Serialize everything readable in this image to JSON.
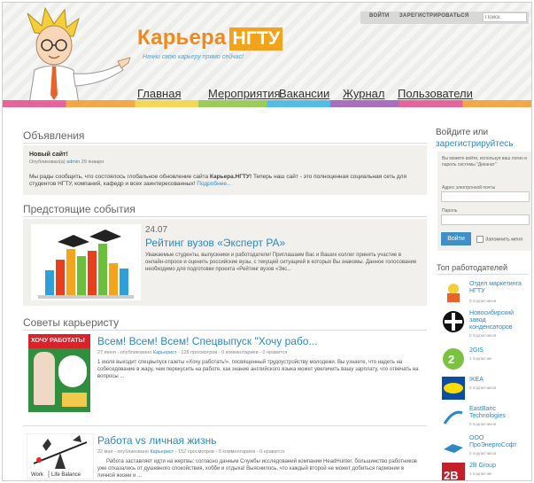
{
  "header": {
    "logo_text": "Карьера",
    "logo_box": "НГТУ",
    "tagline": "Начни свою карьеру прямо сейчас!",
    "login_link": "ВОЙТИ",
    "register_link": "ЗАРЕГИСТРИРОВАТЬСЯ",
    "search_placeholder": "Поиск",
    "nav": [
      "Главная",
      "Мероприятия",
      "Вакансии",
      "Журнал",
      "Пользователи"
    ]
  },
  "announcements": {
    "title": "Объявления",
    "item_title": "Новый сайт!",
    "meta_prefix": "Опубликовал(а)",
    "meta_author": "admin",
    "meta_date": "29 января",
    "text_1": "Мы рады сообщить, что состоялось глобальное обновление сайта",
    "text_bold": "Карьера.НГТУ!",
    "text_2": "Теперь наш сайт - это полноценная социальная сеть для студентов НГТУ, компаний, кафедр и всех заинтересованных!",
    "more": "Подробнее..."
  },
  "events": {
    "title": "Предстоящие события",
    "date": "24.07",
    "event_title": "Рейтинг вузов «Эксперт РА»",
    "text": "Уважаемые студенты, выпускники и работодатели! Приглашаем Вас и Ваших коллег принять участие в онлайн-опросе и оценить российские вузы, с текущей ситуацией в которых Вы знакомы. Данное голосование необходимо для подготовки проекта «Рейтинг вузов «Экс..."
  },
  "advice": {
    "title": "Советы карьеристу",
    "posts": [
      {
        "title": "Всем! Всем! Всем! Спецвыпуск \"Хочу рабо...",
        "meta_pre": "27 июня - опубликовано",
        "meta_cat": "Карьерист",
        "meta_post": "- 128 просмотров - 0 комментариев - 0 нравится",
        "text": "1 июля выходит спецвыпуск газеты «Хочу работать!», посвященный трудоустройству молодежи. Вы узнаете, что надеть на собеседование в жару, чем перекусить на работе, как знание английского языка может увеличить вашу зарплату, что отвечать на вопросы ...",
        "cover_label": "ХОЧУ РАБОТАТЬ!"
      },
      {
        "title": "Работа vs личная жизнь",
        "meta_pre": "22 мая - опубликовано",
        "meta_cat": "Карьерист",
        "meta_post": "- 152 просмотров - 0 комментариев - 0 нравится",
        "text": "Работа заставляет идти на жертвы: согласно данным Службы исследований компании HeadHunter, большинство работников уже отказались от душевного спокойствия, хобби и отдыха! Выяснилось, что каждый второй не может добиться гармонии в личной жизни и ...",
        "img_left": "Work",
        "img_right": "Life Balance"
      }
    ]
  },
  "login": {
    "title_1": "Войдите или",
    "title_2": "зарегистрируйтесь",
    "hint": "Вы можете войти, используя ваш логин и пароль системы \"Деканат\"",
    "email_label": "Адрес электронной почты",
    "password_label": "Пароль",
    "button": "Войти",
    "remember": "Запомнить меня"
  },
  "employers": {
    "title": "Топ работодателей",
    "items": [
      {
        "name": "Отдел маркетинга НГТУ",
        "subs": "0 подписчиков"
      },
      {
        "name": "Новосибирский завод конденсаторов",
        "subs": "0 подписчиков"
      },
      {
        "name": "2GIS",
        "subs": "1 подписчик"
      },
      {
        "name": "IKEA",
        "subs": "0 подписчиков"
      },
      {
        "name": "EastBanc Technologies",
        "subs": "0 подписчиков"
      },
      {
        "name": "ООО ПроЭнергоСофт",
        "subs": "0 подписчиков"
      },
      {
        "name": "2B Group",
        "subs": "1 подписчик"
      }
    ]
  },
  "colors": {
    "accent_blue": "#2d88c4",
    "logo_orange": "#f08a1d"
  }
}
